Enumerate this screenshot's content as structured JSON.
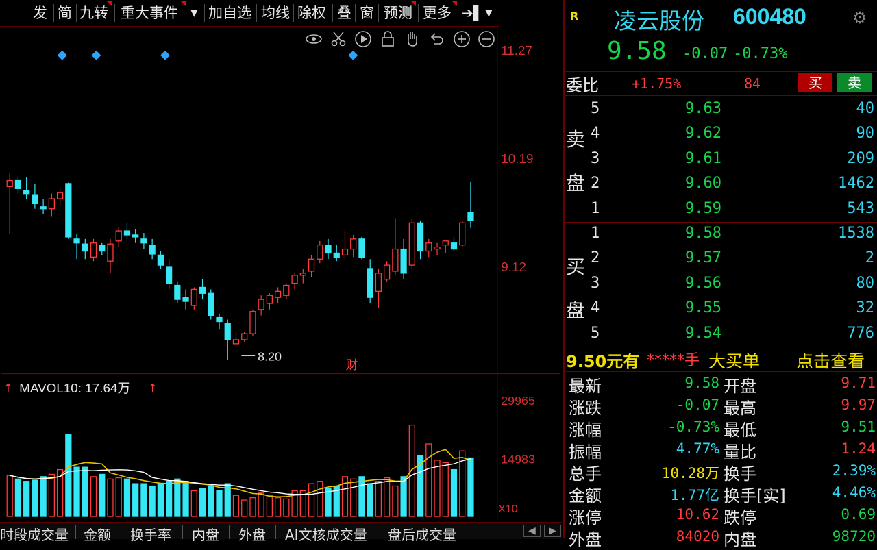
{
  "toolbar": {
    "items": [
      "发",
      "简",
      "九转",
      "重大事件",
      "加自选",
      "均线",
      "除权",
      "叠",
      "窗",
      "预测",
      "更多"
    ]
  },
  "chart_tools": [
    "eye-icon",
    "scissors-icon",
    "play-icon",
    "lock-icon",
    "hand-icon",
    "undo-icon",
    "zoom-in-icon",
    "zoom-out-icon"
  ],
  "price_axis": [
    "11.27",
    "10.19",
    "9.12"
  ],
  "low_marker": "8.20",
  "finance_marker": "财",
  "volume": {
    "indicator": "MAVOL10: 17.64万",
    "axis": [
      "29965",
      "14983"
    ],
    "unit_label": "X10"
  },
  "bottom_tabs": [
    "时段成交量",
    "金额",
    "换手率",
    "内盘",
    "外盘",
    "AI文核成交量",
    "盘后成交量"
  ],
  "stock": {
    "badge": "R",
    "name": "凌云股份",
    "code": "600480",
    "price": "9.58",
    "change": "-0.07",
    "change_pct": "-0.73%"
  },
  "order_ratio": {
    "label": "委比",
    "value": "+1.75%",
    "diff": "84",
    "buy_label": "买",
    "sell_label": "卖"
  },
  "sell_side": {
    "label_1": "卖",
    "label_2": "盘",
    "rows": [
      {
        "level": "5",
        "price": "9.63",
        "vol": "40"
      },
      {
        "level": "4",
        "price": "9.62",
        "vol": "90"
      },
      {
        "level": "3",
        "price": "9.61",
        "vol": "209"
      },
      {
        "level": "2",
        "price": "9.60",
        "vol": "1462"
      },
      {
        "level": "1",
        "price": "9.59",
        "vol": "543"
      }
    ]
  },
  "buy_side": {
    "label_1": "买",
    "label_2": "盘",
    "rows": [
      {
        "level": "1",
        "price": "9.58",
        "vol": "1538"
      },
      {
        "level": "2",
        "price": "9.57",
        "vol": "2"
      },
      {
        "level": "3",
        "price": "9.56",
        "vol": "80"
      },
      {
        "level": "4",
        "price": "9.55",
        "vol": "32"
      },
      {
        "level": "5",
        "price": "9.54",
        "vol": "776"
      }
    ]
  },
  "big_order": {
    "price": "9.50元有",
    "stars": "*****手",
    "label": "大买单",
    "link": "点击查看"
  },
  "stats": [
    {
      "l1": "最新",
      "v1": "9.58",
      "c1": "green",
      "l2": "开盘",
      "v2": "9.71",
      "c2": "red"
    },
    {
      "l1": "涨跌",
      "v1": "-0.07",
      "c1": "green",
      "l2": "最高",
      "v2": "9.97",
      "c2": "red"
    },
    {
      "l1": "涨幅",
      "v1": "-0.73%",
      "c1": "green",
      "l2": "最低",
      "v2": "9.51",
      "c2": "green"
    },
    {
      "l1": "振幅",
      "v1": "4.77%",
      "c1": "cyan",
      "l2": "量比",
      "v2": "1.24",
      "c2": "red"
    },
    {
      "l1": "总手",
      "v1": "10.28万",
      "c1": "yellow",
      "l2": "换手",
      "v2": "2.39%",
      "c2": "cyan"
    },
    {
      "l1": "金额",
      "v1": "1.77亿",
      "c1": "cyan",
      "l2": "换手[实]",
      "v2": "4.46%",
      "c2": "cyan"
    },
    {
      "l1": "涨停",
      "v1": "10.62",
      "c1": "red",
      "l2": "跌停",
      "v2": "0.69",
      "c2": "green"
    },
    {
      "l1": "外盘",
      "v1": "84020",
      "c1": "red",
      "l2": "内盘",
      "v2": "98720",
      "c2": "green"
    }
  ],
  "colors": {
    "up": "#ff3b3b",
    "down": "#35e6f5",
    "ma": "#e6c200",
    "ma2": "#ffffff",
    "marker": "#2aa4ff"
  }
}
